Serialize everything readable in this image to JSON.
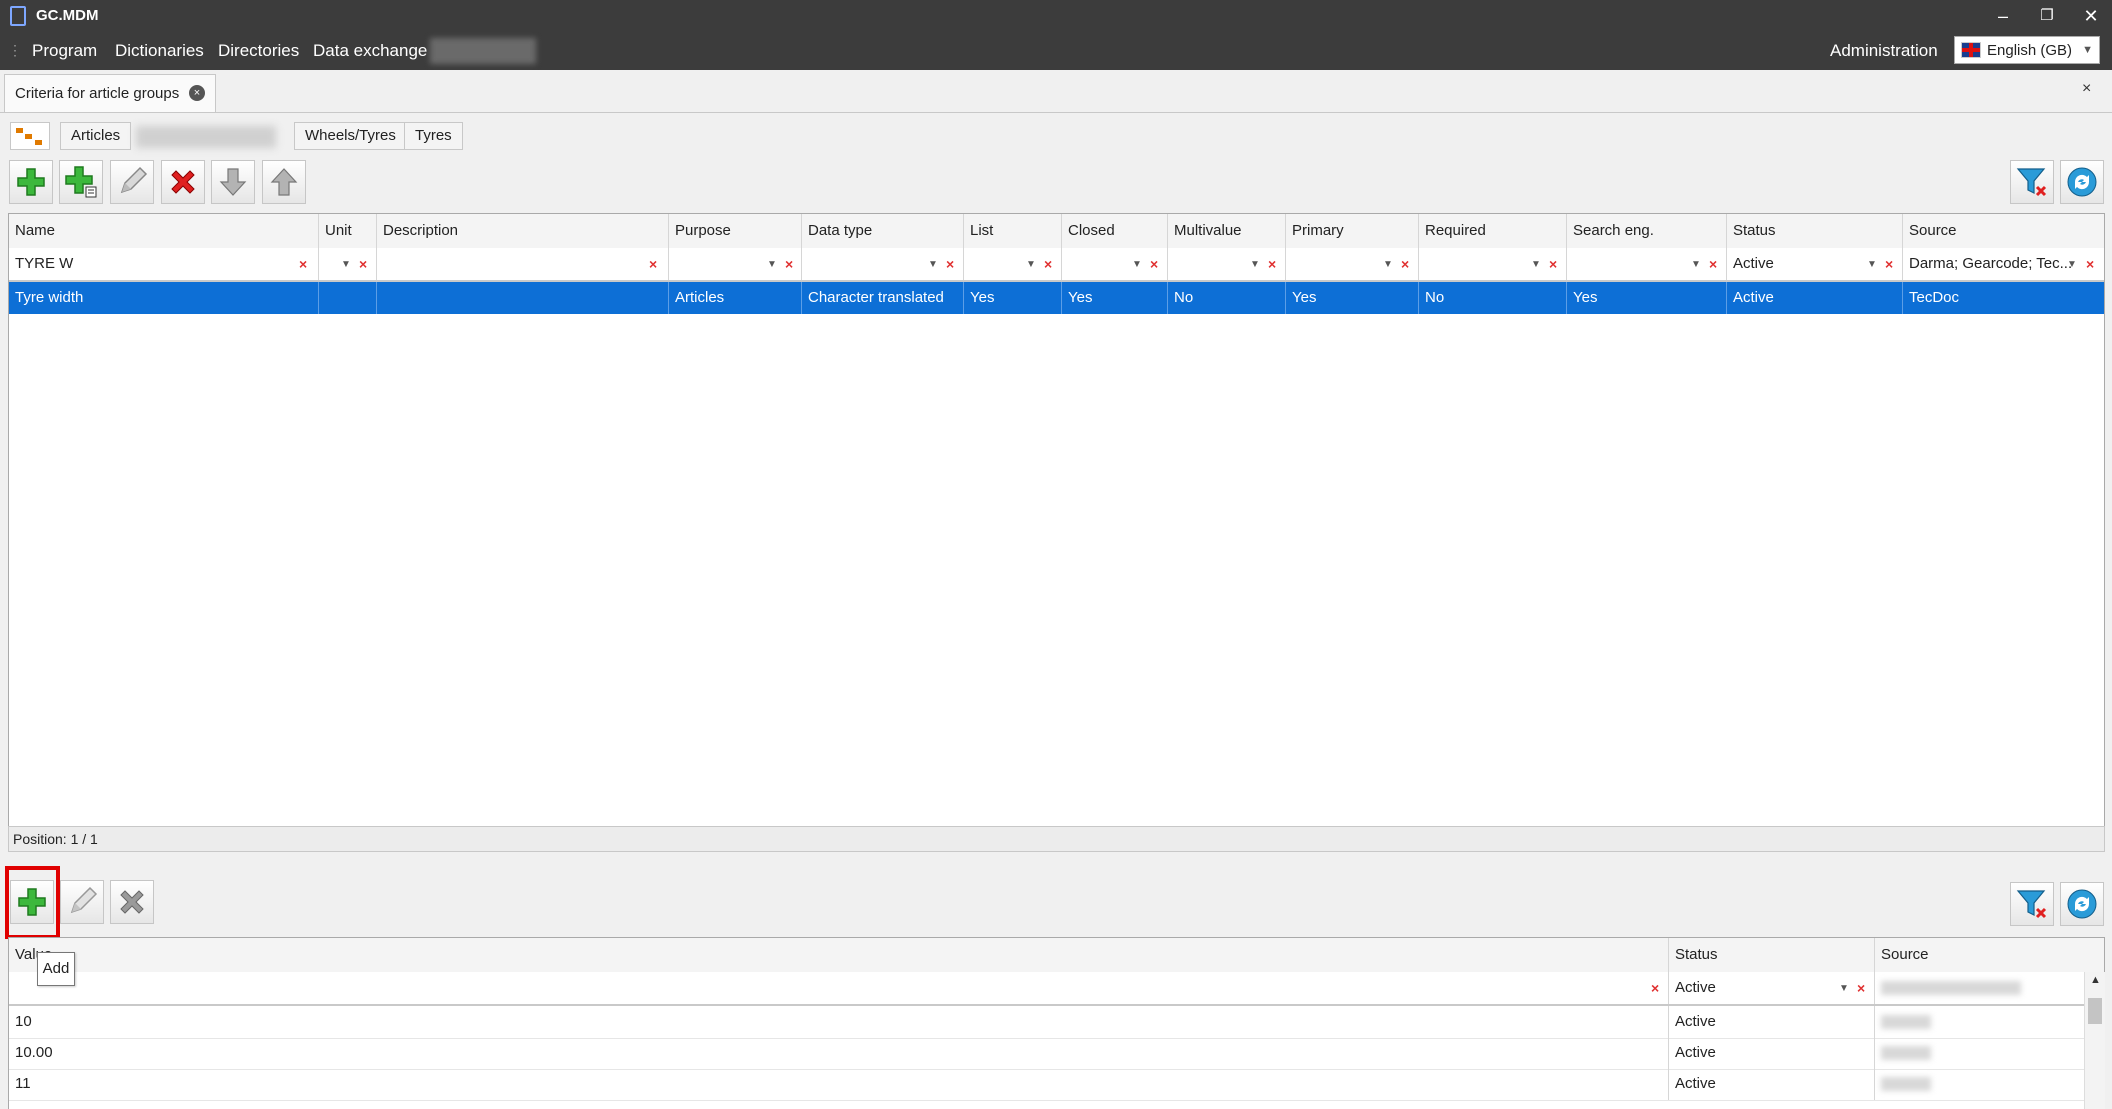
{
  "app": {
    "title": "GC.MDM",
    "window_controls": {
      "minimize": "–",
      "restore": "❐",
      "close": "✕"
    }
  },
  "menu": {
    "items": [
      "Program",
      "Dictionaries",
      "Directories",
      "Data exchange"
    ],
    "right": "Administration",
    "language": "English (GB)"
  },
  "doc_tab": {
    "label": "Criteria for article groups",
    "close": "×"
  },
  "panel_close": "×",
  "breadcrumbs": [
    "Articles",
    "Wheels/Tyres",
    "Tyres"
  ],
  "top_grid": {
    "columns": [
      "Name",
      "Unit",
      "Description",
      "Purpose",
      "Data type",
      "List",
      "Closed",
      "Multivalue",
      "Primary",
      "Required",
      "Search eng.",
      "Status",
      "Source"
    ],
    "filters": {
      "Name": "TYRE W",
      "Status": "Active",
      "Source": "Darma; Gearcode; Tec..."
    },
    "rows": [
      [
        "Tyre width",
        "",
        "",
        "Articles",
        "Character translated",
        "Yes",
        "Yes",
        "No",
        "Yes",
        "No",
        "Yes",
        "Active",
        "TecDoc"
      ]
    ],
    "position": "Position: 1 / 1"
  },
  "bottom_grid": {
    "columns": [
      "Value",
      "Status",
      "Source"
    ],
    "filters": {
      "Status": "Active"
    },
    "rows": [
      [
        "10",
        "Active"
      ],
      [
        "10.00",
        "Active"
      ],
      [
        "11",
        "Active"
      ]
    ]
  },
  "tooltip": "Add",
  "colors": {
    "selection": "#0d6fd6",
    "titlebar": "#3c3c3c",
    "highlight": "#e00000"
  }
}
